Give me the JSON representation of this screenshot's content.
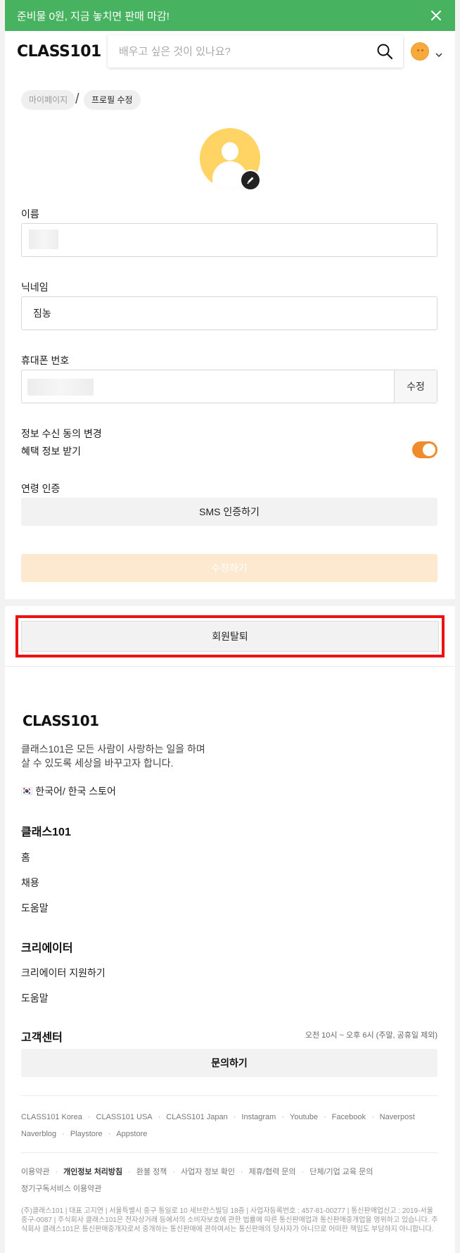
{
  "promo": {
    "text": "준비물 0원, 지금 놓치면 판매 마감!"
  },
  "header": {
    "logo": "CLASS101",
    "search_placeholder": "배우고 싶은 것이 있나요?"
  },
  "breadcrumb": {
    "items": [
      "마이페이지",
      "프로필 수정"
    ],
    "separator": "/"
  },
  "form": {
    "name_label": "이름",
    "nickname_label": "닉네임",
    "nickname_value": "짐농",
    "phone_label": "휴대폰 번호",
    "phone_edit_label": "수정",
    "consent_label": "정보 수신 동의 변경",
    "benefit_label": "혜택 정보 받기",
    "benefit_enabled": true,
    "age_label": "연령 인증",
    "sms_button": "SMS 인증하기",
    "submit_button": "수정하기"
  },
  "withdraw": {
    "label": "회원탈퇴"
  },
  "footer": {
    "logo": "CLASS101",
    "desc_line1": "클래스101은 모든 사람이 사랑하는 일을 하며",
    "desc_line2": "살 수 있도록 세상을 바꾸고자 합니다.",
    "lang_flag": "🇰🇷",
    "lang": "한국어/ 한국 스토어",
    "section1": {
      "title": "클래스101",
      "links": [
        "홈",
        "채용",
        "도움말"
      ]
    },
    "section2": {
      "title": "크리에이터",
      "links": [
        "크리에이터 지원하기",
        "도움말"
      ]
    },
    "section3": {
      "title": "고객센터",
      "hours": "오전 10시 ~ 오후 6시 (주말, 공휴일 제외)",
      "inquiry_button": "문의하기"
    },
    "social": [
      "CLASS101 Korea",
      "CLASS101 USA",
      "CLASS101 Japan",
      "Instagram",
      "Youtube",
      "Facebook",
      "Naverpost",
      "Naverblog",
      "Playstore",
      "Appstore"
    ],
    "policy": [
      "이용약관",
      "개인정보 처리방침",
      "환불 정책",
      "사업자 정보 확인",
      "제휴/협력 문의",
      "단체/기업 교육 문의",
      "정기구독서비스 이용약관"
    ],
    "company_info": "(주)클래스101 | 대표 고지연 | 서울특별시 중구 통일로 10 세브란스빌딩 18층 | 사업자등록번호 : 457-81-00277 | 통신판매업신고 : 2019-서울중구-0087 | 주식회사 클래스101은 전자상거래 등에서의 소비자보호에 관한 법률에 따른 통신판매업과 통신판매중개업을 영위하고 있습니다. 주식회사 클래스101은 통신판매중개자로서 중개하는 통신판매에 관하여서는 통신판매의 당사자가 아니므로 어떠한 책임도 부담하지 아니합니다."
  },
  "colors": {
    "promo_bg": "#47b25f",
    "accent": "#f08b2b",
    "highlight_border": "#ee1111"
  }
}
